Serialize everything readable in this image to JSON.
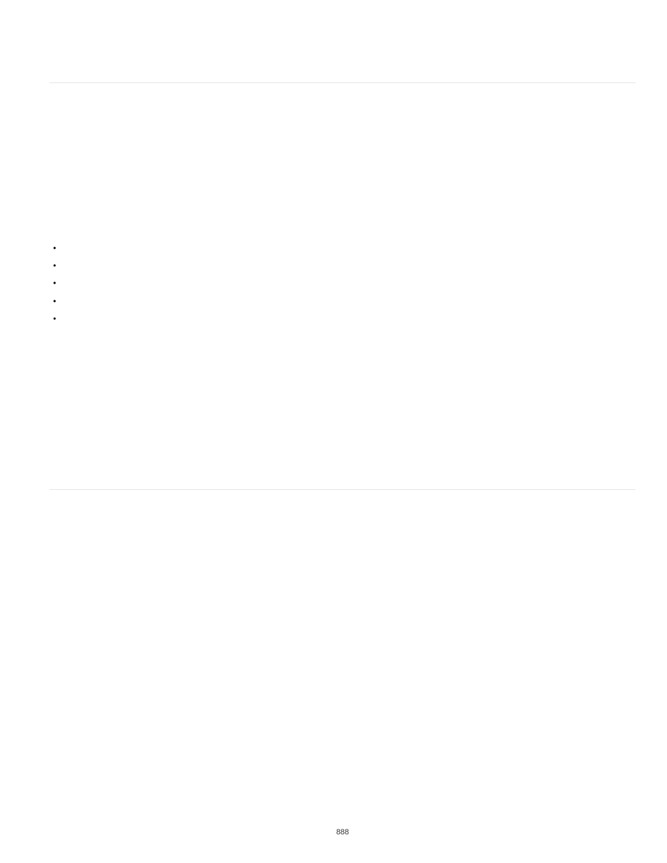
{
  "page": {
    "number": "888"
  },
  "list": {
    "items": [
      "",
      "",
      "",
      "",
      ""
    ]
  }
}
